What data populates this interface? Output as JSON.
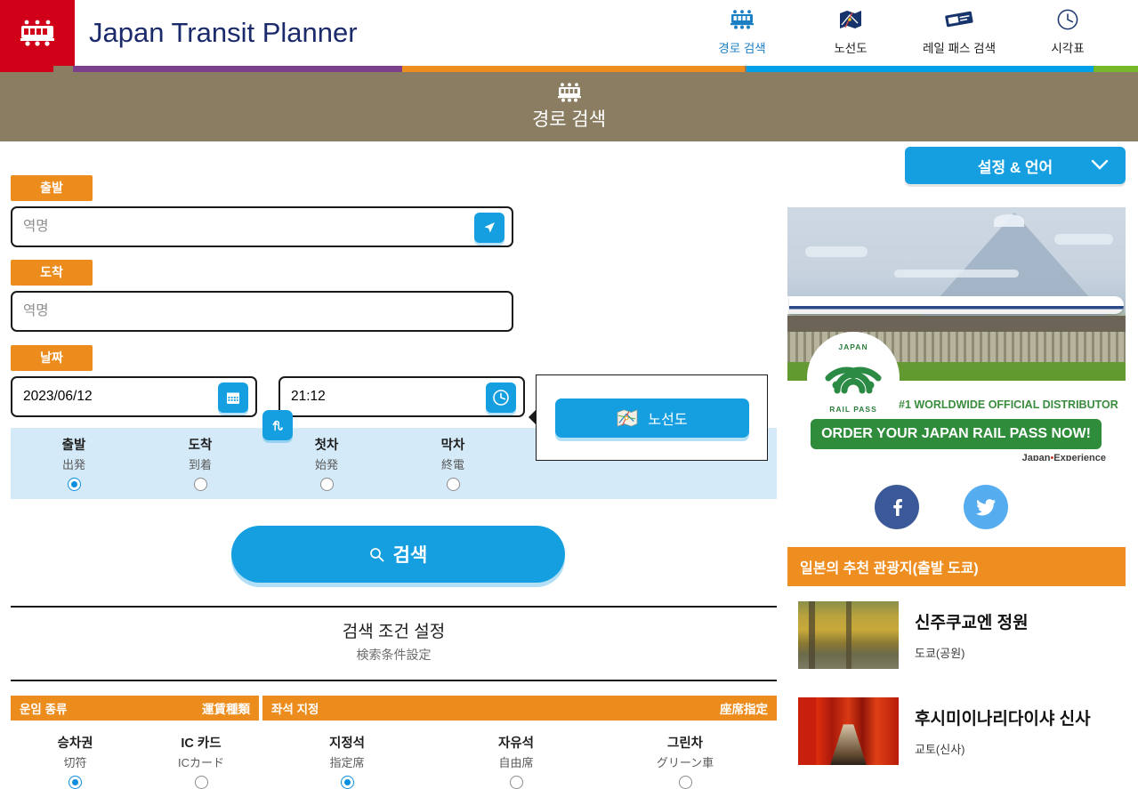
{
  "header": {
    "logo_icon": "train-logo-icon",
    "site_title": "Japan Transit Planner",
    "nav": [
      {
        "label": "경로 검색",
        "icon": "train-icon",
        "active": true
      },
      {
        "label": "노선도",
        "icon": "route-map-icon",
        "active": false
      },
      {
        "label": "레일 패스 검색",
        "icon": "rail-pass-ticket-icon",
        "active": false
      },
      {
        "label": "시각표",
        "icon": "clock-icon",
        "active": false
      }
    ],
    "stripe_colors": [
      "#d10019",
      "#7b3f8c",
      "#ef8e20",
      "#00a0e9",
      "#76b82a"
    ]
  },
  "banner": {
    "icon": "train-icon",
    "title": "경로 검색",
    "bg": "#8b7d61"
  },
  "settings": {
    "label": "설정 & 언어",
    "chevron_icon": "chevron-down-icon",
    "bg": "#169fe0"
  },
  "form": {
    "departure_tag": "출발",
    "departure_placeholder": "역명",
    "departure_value": "",
    "gps_icon": "location-arrow-icon",
    "arrival_tag": "도착",
    "arrival_placeholder": "역명",
    "arrival_value": "",
    "swap_icon": "swap-vertical-icon",
    "date_tag": "날짜",
    "date_value": "2023/06/12",
    "calendar_icon": "calendar-icon",
    "time_value": "21:12",
    "clock_icon": "clock-icon",
    "time_modes": [
      {
        "ko": "출발",
        "ja": "出発",
        "selected": true
      },
      {
        "ko": "도착",
        "ja": "到着",
        "selected": false
      },
      {
        "ko": "첫차",
        "ja": "始発",
        "selected": false
      },
      {
        "ko": "막차",
        "ja": "終電",
        "selected": false
      }
    ],
    "search_label": "검색",
    "search_icon": "search-icon"
  },
  "callout": {
    "button_label": "노선도",
    "button_icon": "route-map-icon"
  },
  "conditions": {
    "title_ko": "검색 조건 설정",
    "title_ja": "検索条件設定",
    "fare_bar_ko": "운임 종류",
    "fare_bar_ja": "運賃種類",
    "seat_bar_ko": "좌석 지정",
    "seat_bar_ja": "座席指定",
    "fare_options": [
      {
        "ko": "승차권",
        "ja": "切符",
        "selected": true
      },
      {
        "ko": "IC 카드",
        "ja": "ICカード",
        "selected": false
      }
    ],
    "seat_options": [
      {
        "ko": "지정석",
        "ja": "指定席",
        "selected": true
      },
      {
        "ko": "자유석",
        "ja": "自由席",
        "selected": false
      },
      {
        "ko": "그린차",
        "ja": "グリーン車",
        "selected": false
      }
    ]
  },
  "ad": {
    "seal_top": "JAPAN",
    "seal_bottom": "RAIL PASS",
    "tagline": "#1 WORLDWIDE OFFICIAL DISTRIBUTOR",
    "cta": "ORDER YOUR JAPAN RAIL PASS NOW!",
    "brand_prefix": "Japan",
    "brand_dot": "•",
    "brand_suffix": "Experience",
    "cta_color": "#2f8c3b"
  },
  "social": [
    {
      "name": "facebook",
      "glyph": "f",
      "color": "#3b5998"
    },
    {
      "name": "twitter",
      "glyph": "bird",
      "color": "#55acee"
    }
  ],
  "spots": {
    "heading": "일본의 추천 관광지(출발 도쿄)",
    "heading_bg": "#ef8e20",
    "items": [
      {
        "name": "신주쿠교엔 정원",
        "location": "도쿄(공원)",
        "thumb": "autumn-garden-photo"
      },
      {
        "name": "후시미이나리다이샤 신사",
        "location": "교토(신사)",
        "thumb": "red-torii-gates-photo"
      }
    ]
  }
}
